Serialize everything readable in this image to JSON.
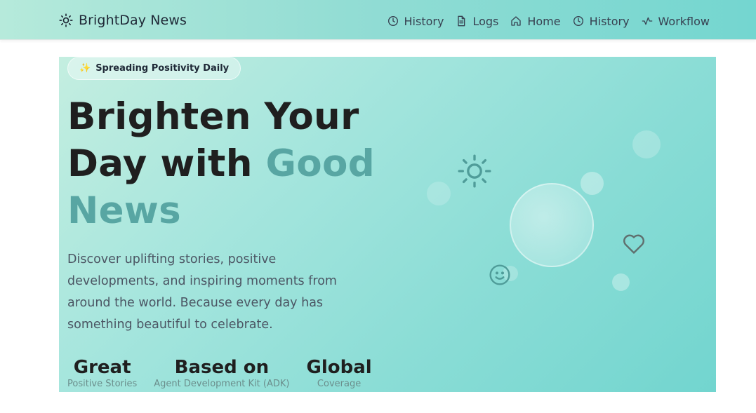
{
  "brand": {
    "name": "BrightDay News",
    "icon": "sun-icon"
  },
  "nav": [
    {
      "label": "History",
      "icon": "clock-icon"
    },
    {
      "label": "Logs",
      "icon": "file-icon"
    },
    {
      "label": "Home",
      "icon": "home-icon"
    },
    {
      "label": "History",
      "icon": "clock-icon"
    },
    {
      "label": "Workflow",
      "icon": "activity-icon"
    }
  ],
  "hero": {
    "badge": "Spreading Positivity Daily",
    "badge_icon": "sparkle-icon",
    "title_line1": "Brighten Your",
    "title_line2_plain": "Day with ",
    "title_line2_accent": "Good",
    "title_line3_accent": "News",
    "description": "Discover uplifting stories, positive developments, and inspiring moments from around the world. Because every day has something beautiful to celebrate.",
    "stats": [
      {
        "value": "Great",
        "label": "Positive Stories"
      },
      {
        "value": "Based on",
        "label": "Agent Development Kit (ADK)"
      },
      {
        "value": "Global",
        "label": "Coverage"
      }
    ]
  },
  "colors": {
    "accent": "#58a6a3",
    "nav_gradient_start": "#b6eadb",
    "nav_gradient_end": "#74d6d0",
    "hero_gradient_start": "#c4eee0",
    "hero_gradient_end": "#72d5cf"
  }
}
